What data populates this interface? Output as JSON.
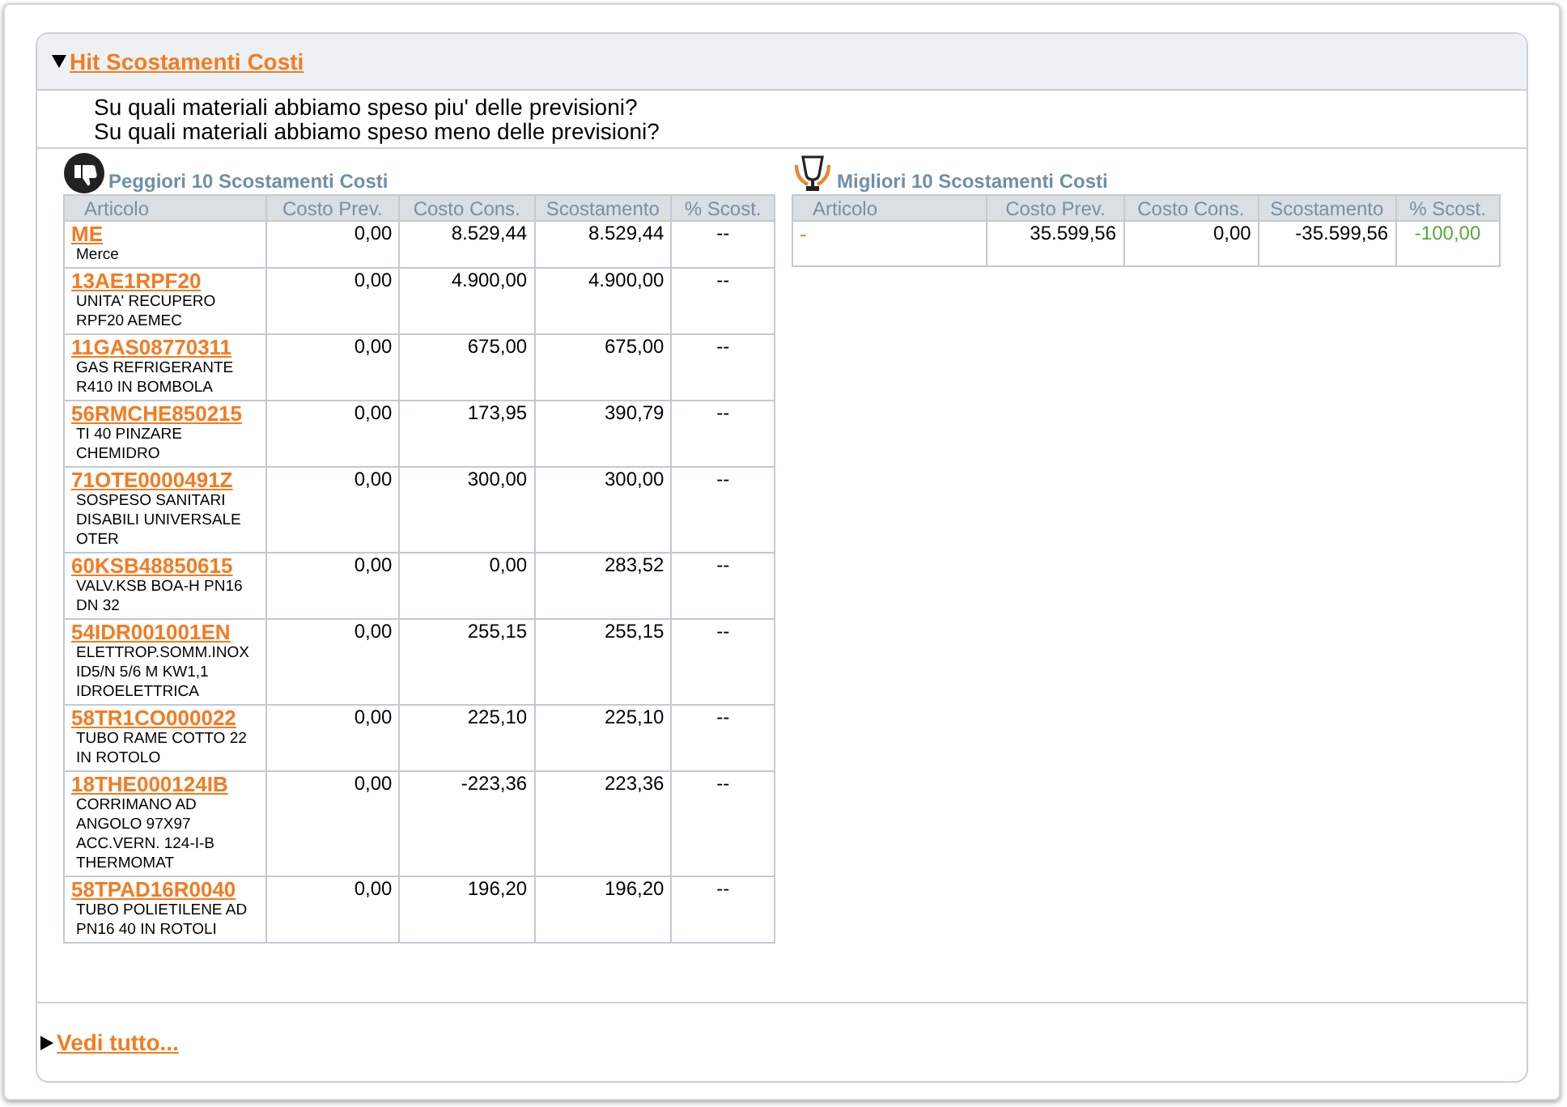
{
  "panel": {
    "title": "Hit Scostamenti Costi",
    "expanded": true,
    "questions": [
      "Su quali materiali abbiamo speso piu' delle previsioni?",
      "Su quali materiali abbiamo speso meno delle previsioni?"
    ]
  },
  "tables": [
    {
      "kind": "worst",
      "title": "Peggiori 10 Scostamenti Costi",
      "columns": [
        "Articolo",
        "Costo Prev.",
        "Costo Cons.",
        "Scostamento",
        "% Scost."
      ],
      "rows": [
        {
          "code": "ME",
          "description": "Merce",
          "prev": "0,00",
          "cons": "8.529,44",
          "scost": "8.529,44",
          "pct": "--"
        },
        {
          "code": "13AE1RPF20",
          "description": "UNITA' RECUPERO RPF20 AEMEC",
          "prev": "0,00",
          "cons": "4.900,00",
          "scost": "4.900,00",
          "pct": "--"
        },
        {
          "code": "11GAS08770311",
          "description": "GAS REFRIGERANTE R410 IN BOMBOLA",
          "prev": "0,00",
          "cons": "675,00",
          "scost": "675,00",
          "pct": "--"
        },
        {
          "code": "56RMCHE850215",
          "description": "TI 40 PINZARE CHEMIDRO",
          "prev": "0,00",
          "cons": "173,95",
          "scost": "390,79",
          "pct": "--"
        },
        {
          "code": "71OTE0000491Z",
          "description": "SOSPESO SANITARI DISABILI UNIVERSALE OTER",
          "prev": "0,00",
          "cons": "300,00",
          "scost": "300,00",
          "pct": "--"
        },
        {
          "code": "60KSB48850615",
          "description": "VALV.KSB BOA-H PN16 DN 32",
          "prev": "0,00",
          "cons": "0,00",
          "scost": "283,52",
          "pct": "--"
        },
        {
          "code": "54IDR001001EN",
          "description": "ELETTROP.SOMM.INOX ID5/N 5/6 M KW1,1 IDROELETTRICA",
          "prev": "0,00",
          "cons": "255,15",
          "scost": "255,15",
          "pct": "--"
        },
        {
          "code": "58TR1CO000022",
          "description": "TUBO RAME COTTO 22 IN ROTOLO",
          "prev": "0,00",
          "cons": "225,10",
          "scost": "225,10",
          "pct": "--"
        },
        {
          "code": "18THE000124IB",
          "description": "CORRIMANO AD ANGOLO 97X97 ACC.VERN. 124-I-B THERMOMAT",
          "prev": "0,00",
          "cons": "-223,36",
          "scost": "223,36",
          "pct": "--"
        },
        {
          "code": "58TPAD16R0040",
          "description": "TUBO POLIETILENE AD PN16 40 IN ROTOLI",
          "prev": "0,00",
          "cons": "196,20",
          "scost": "196,20",
          "pct": "--"
        }
      ]
    },
    {
      "kind": "best",
      "title": "Migliori 10 Scostamenti Costi",
      "columns": [
        "Articolo",
        "Costo Prev.",
        "Costo Cons.",
        "Scostamento",
        "% Scost."
      ],
      "rows": [
        {
          "code": "-",
          "prev": "35.599,56",
          "cons": "0,00",
          "scost": "-35.599,56",
          "pct": "-100,00",
          "color": "#5aa53a"
        }
      ]
    }
  ],
  "footer": {
    "link": "Vedi tutto...",
    "expanded": false
  }
}
